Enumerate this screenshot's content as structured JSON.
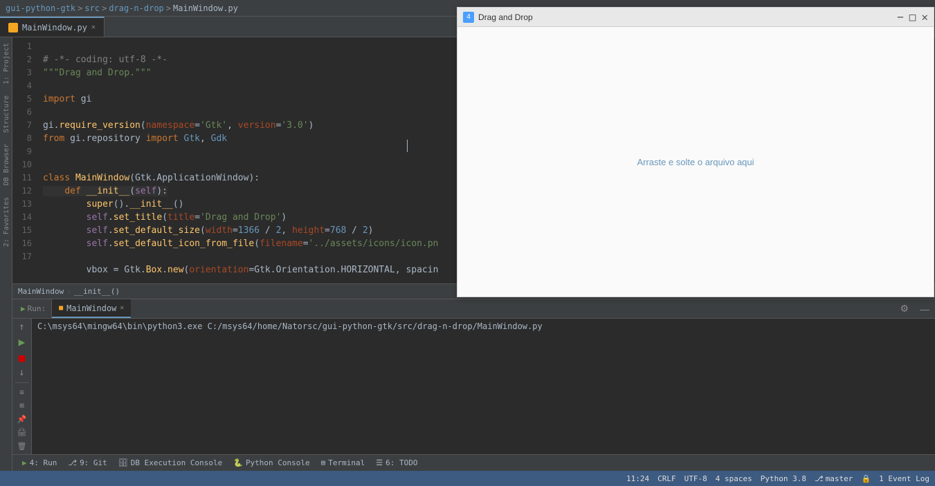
{
  "breadcrumb": {
    "parts": [
      "gui-python-gtk",
      "src",
      "drag-n-drop",
      "MainWindow.py"
    ],
    "separators": [
      ">",
      ">",
      ">"
    ]
  },
  "editor_tab": {
    "label": "MainWindow.py",
    "active": true
  },
  "code": {
    "lines": [
      {
        "num": 1,
        "content": "# -*- coding: utf-8 -*-",
        "type": "comment"
      },
      {
        "num": 2,
        "content": "\"\"\"Drag and Drop.\"\"\"",
        "type": "docstring"
      },
      {
        "num": 3,
        "content": "",
        "type": "empty"
      },
      {
        "num": 4,
        "content": "import gi",
        "type": "import"
      },
      {
        "num": 5,
        "content": "",
        "type": "empty"
      },
      {
        "num": 6,
        "content": "gi.require_version(namespace='Gtk', version='3.0')",
        "type": "call"
      },
      {
        "num": 7,
        "content": "from gi.repository import Gtk, Gdk",
        "type": "import"
      },
      {
        "num": 8,
        "content": "",
        "type": "empty"
      },
      {
        "num": 9,
        "content": "",
        "type": "empty"
      },
      {
        "num": 10,
        "content": "class MainWindow(Gtk.ApplicationWindow):",
        "type": "class"
      },
      {
        "num": 11,
        "content": "    def __init__(self):",
        "type": "def"
      },
      {
        "num": 12,
        "content": "        super().__init__()",
        "type": "code"
      },
      {
        "num": 13,
        "content": "        self.set_title(title='Drag and Drop')",
        "type": "code"
      },
      {
        "num": 14,
        "content": "        self.set_default_size(width=1366 / 2, height=768 / 2)",
        "type": "code"
      },
      {
        "num": 15,
        "content": "        self.set_default_icon_from_file(filename='../assets/icons/icon.pn",
        "type": "code"
      },
      {
        "num": 16,
        "content": "",
        "type": "empty"
      },
      {
        "num": 17,
        "content": "        vbox = Gtk.Box.new(orientation=Gtk.Orientation.HORIZONTAL, spacin",
        "type": "code"
      }
    ]
  },
  "breadcrumb_bottom": {
    "class": "MainWindow",
    "method": "__init__()"
  },
  "drag_window": {
    "title": "Drag and Drop",
    "icon_label": "4",
    "drop_text": "Arraste e solte o arquivo aqui"
  },
  "run_panel": {
    "tab_label": "MainWindow",
    "command": "C:\\msys64\\mingw64\\bin\\python3.exe C:/msys64/home/Natorsc/gui-python-gtk/src/drag-n-drop/MainWindow.py"
  },
  "bottom_toolbar": {
    "items": [
      {
        "id": "run",
        "icon": "▶",
        "label": "4: Run"
      },
      {
        "id": "git",
        "icon": "⎇",
        "label": "9: Git"
      },
      {
        "id": "db",
        "icon": "🗄",
        "label": "DB Execution Console"
      },
      {
        "id": "python",
        "icon": "🐍",
        "label": "Python Console"
      },
      {
        "id": "terminal",
        "icon": "⊞",
        "label": "Terminal"
      },
      {
        "id": "todo",
        "icon": "☰",
        "label": "6: TODO"
      }
    ]
  },
  "status_bar": {
    "time": "11:24",
    "encoding_line": "CRLF",
    "encoding": "UTF-8",
    "indent": "4 spaces",
    "python_version": "Python 3.8",
    "branch_icon": "⎇",
    "branch": "master",
    "lock_icon": "🔒",
    "event_log": "1 Event Log"
  },
  "sidebar_labels": [
    "2: Favorites",
    "1: Project",
    "Structure"
  ],
  "colors": {
    "keyword": "#cc7832",
    "string": "#6a8759",
    "comment": "#808080",
    "number": "#6897bb",
    "function": "#ffc66d",
    "class_name": "#a9b7c6",
    "self": "#9876aa",
    "accent": "#3d5a80"
  }
}
